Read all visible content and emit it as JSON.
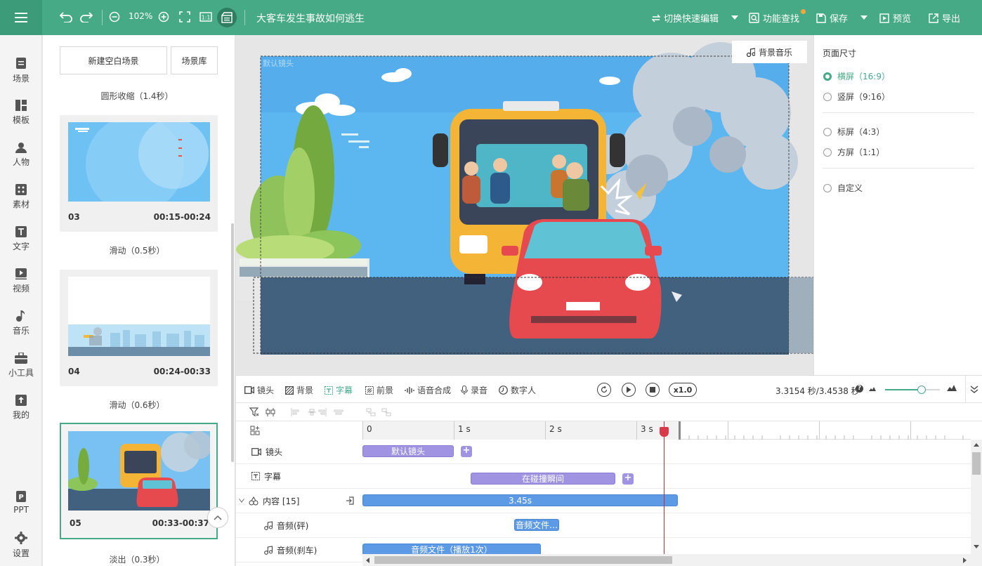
{
  "topbar": {
    "zoom": "102%",
    "title": "大客车发生事故如何逃生",
    "quick_edit": "切换快速编辑",
    "find": "功能查找",
    "save": "保存",
    "preview": "预览",
    "export": "导出"
  },
  "sidebar": {
    "items": [
      {
        "label": "场景"
      },
      {
        "label": "模板"
      },
      {
        "label": "人物"
      },
      {
        "label": "素材"
      },
      {
        "label": "文字"
      },
      {
        "label": "视频"
      },
      {
        "label": "音乐"
      },
      {
        "label": "小工具"
      },
      {
        "label": "我的"
      },
      {
        "label": "PPT"
      },
      {
        "label": "设置"
      }
    ]
  },
  "scene_panel": {
    "new_blank": "新建空白场景",
    "library": "场景库",
    "transitions": [
      "圆形收缩（1.4秒）",
      "滑动（0.5秒）",
      "滑动（0.6秒）",
      "淡出（0.3秒）"
    ],
    "scenes": [
      {
        "num": "03",
        "time": "00:15-00:24"
      },
      {
        "num": "04",
        "time": "00:24-00:33"
      },
      {
        "num": "05",
        "time": "00:33-00:37"
      }
    ]
  },
  "canvas": {
    "bgm": "背景音乐",
    "camera_label": "默认镜头"
  },
  "props": {
    "title": "页面尺寸",
    "options": [
      {
        "label": "横屏（16:9）",
        "selected": true
      },
      {
        "label": "竖屏（9:16）",
        "selected": false
      },
      {
        "label": "标屏（4:3）",
        "selected": false
      },
      {
        "label": "方屏（1:1）",
        "selected": false
      },
      {
        "label": "自定义",
        "selected": false
      }
    ]
  },
  "timeline": {
    "tabs": [
      "镜头",
      "背景",
      "字幕",
      "前景",
      "语音合成",
      "录音",
      "数字人"
    ],
    "active_tab": "字幕",
    "speed": "x1.0",
    "time_info": "3.3154 秒/3.4538 秒",
    "ruler": [
      "0",
      "1 s",
      "2 s",
      "3 s"
    ],
    "tracks": [
      {
        "label": "镜头",
        "clip": "默认镜头"
      },
      {
        "label": "字幕",
        "clip": "在碰撞瞬间"
      },
      {
        "label": "内容 [15]",
        "clip": "3.45s"
      },
      {
        "label": "音频(砰)",
        "clip": "音频文件…"
      },
      {
        "label": "音频(刹车)",
        "clip": "音频文件（播放1次）"
      }
    ]
  },
  "colors": {
    "accent": "#46aa87",
    "clip_purple": "#a093e2",
    "clip_blue": "#5c9ae6",
    "playhead": "#c8283b"
  }
}
